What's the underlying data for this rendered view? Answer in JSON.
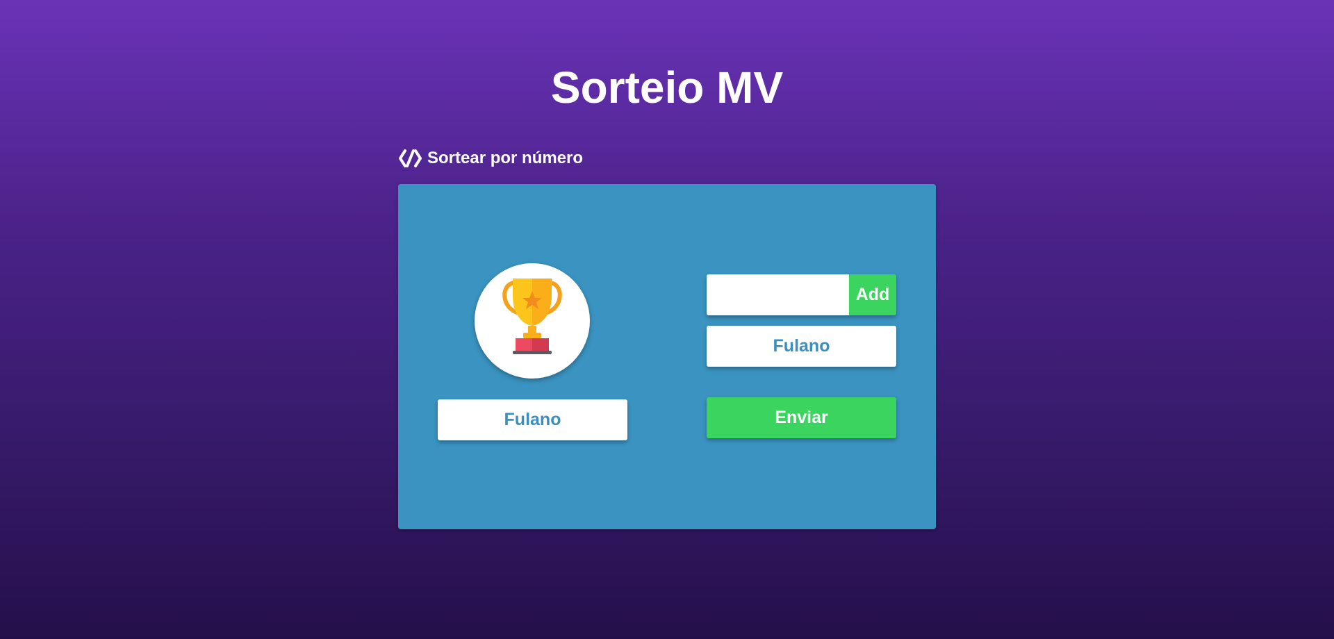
{
  "header": {
    "title": "Sorteio MV"
  },
  "section": {
    "icon": "code-slash-icon",
    "label": "Sortear por número"
  },
  "card": {
    "background_color": "#3a93c0",
    "trophy_icon": "trophy-icon",
    "winner_name": "Fulano"
  },
  "form": {
    "name_input_value": "",
    "add_label": "Add",
    "participants": [
      "Fulano"
    ],
    "send_label": "Enviar"
  },
  "colors": {
    "accent_green": "#3bd45e",
    "name_text": "#3a8fc0",
    "background_top": "#6a33b7",
    "background_bottom": "#250f4a"
  }
}
